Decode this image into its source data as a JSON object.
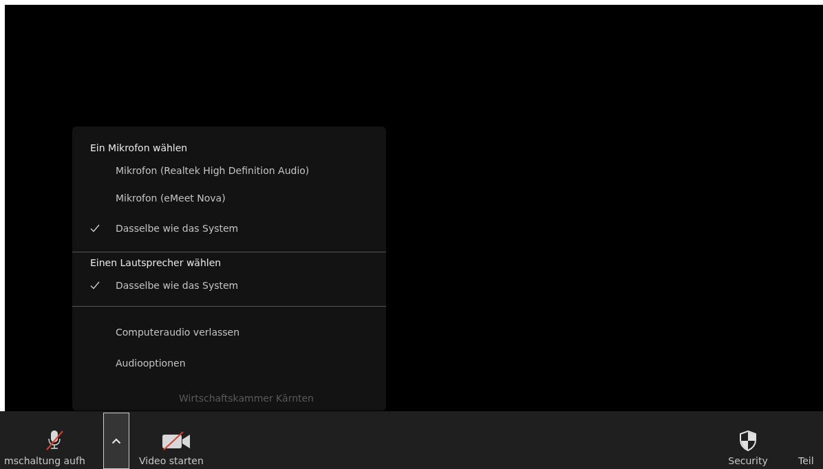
{
  "audio_menu": {
    "sections": [
      {
        "heading": "Ein Mikrofon wählen",
        "items": [
          {
            "label": "Mikrofon (Realtek High Definition Audio)",
            "checked": false
          },
          {
            "label": "Mikrofon (eMeet Nova)",
            "checked": false
          },
          {
            "label": "Dasselbe wie das System",
            "checked": true
          }
        ]
      },
      {
        "heading": "Einen Lautsprecher wählen",
        "items": [
          {
            "label": "Dasselbe wie das System",
            "checked": true
          }
        ]
      }
    ],
    "actions": [
      "Computeraudio verlassen",
      "Audiooptionen"
    ]
  },
  "participant_name": "Wirtschaftskammer Kärnten",
  "toolbar": [
    {
      "kind": "mic",
      "label": "mschaltung aufh",
      "muted": true
    },
    {
      "kind": "caret",
      "selected": true
    },
    {
      "kind": "video",
      "label": "Video starten",
      "muted": true
    },
    {
      "kind": "spacer"
    },
    {
      "kind": "security",
      "label": "Security"
    },
    {
      "kind": "share",
      "label": "Teil"
    }
  ]
}
